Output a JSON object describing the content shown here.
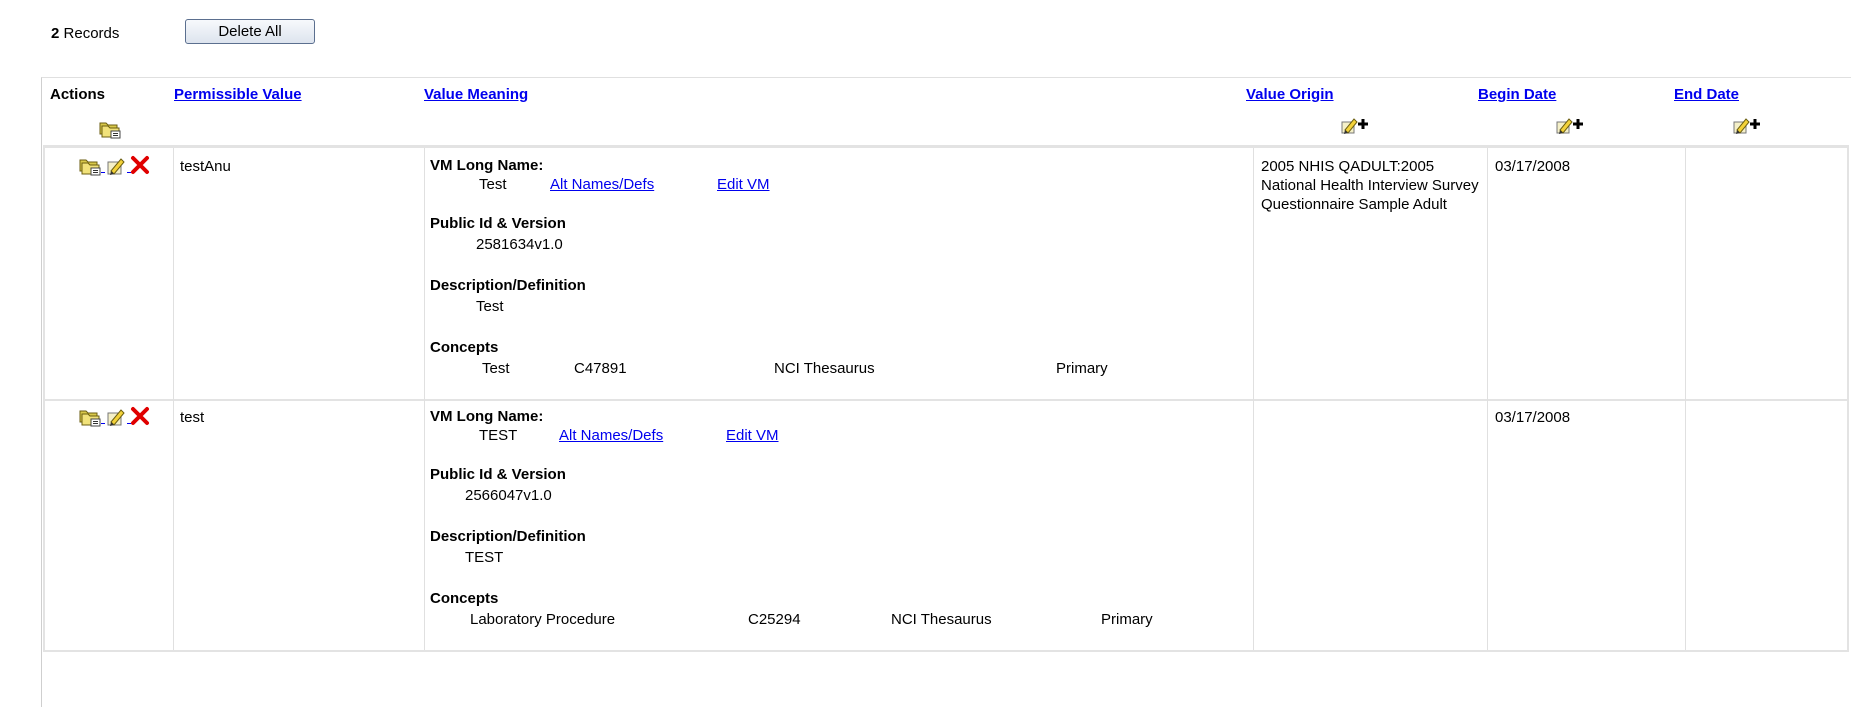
{
  "toolbar": {
    "record_count": "2",
    "records_label": "Records",
    "delete_all_label": "Delete All"
  },
  "columns": {
    "actions": "Actions",
    "permissible_value": "Permissible Value",
    "value_meaning": "Value Meaning",
    "value_origin": "Value Origin",
    "begin_date": "Begin Date",
    "end_date": "End Date"
  },
  "labels": {
    "vm_long_name": "VM Long Name:",
    "public_id": "Public Id & Version",
    "description": "Description/Definition",
    "concepts": "Concepts",
    "alt_names": "Alt Names/Defs",
    "edit_vm": "Edit VM"
  },
  "rows": [
    {
      "permissible_value": "testAnu",
      "vm_long_name": "Test",
      "public_id_version": "2581634v1.0",
      "description": "Test",
      "concept_name": "Test",
      "concept_code": "C47891",
      "concept_source": "NCI Thesaurus",
      "concept_type": "Primary",
      "value_origin": "2005 NHIS QADULT:2005 National Health Interview Survey Questionnaire Sample Adult",
      "begin_date": "03/17/2008",
      "end_date": ""
    },
    {
      "permissible_value": "test",
      "vm_long_name": "TEST",
      "public_id_version": "2566047v1.0",
      "description": "TEST",
      "concept_name": "Laboratory Procedure",
      "concept_code": "C25294",
      "concept_source": "NCI Thesaurus",
      "concept_type": "Primary",
      "value_origin": "",
      "begin_date": "03/17/2008",
      "end_date": ""
    }
  ],
  "icons": {
    "add": "folder-add-icon",
    "edit": "pencil-edit-icon",
    "delete": "red-x-delete-icon",
    "bulk_edit": "pencil-plus-icon"
  },
  "colors": {
    "link": "#0000ee",
    "delete_x": "#e00000",
    "border": "#e3e3e3"
  }
}
